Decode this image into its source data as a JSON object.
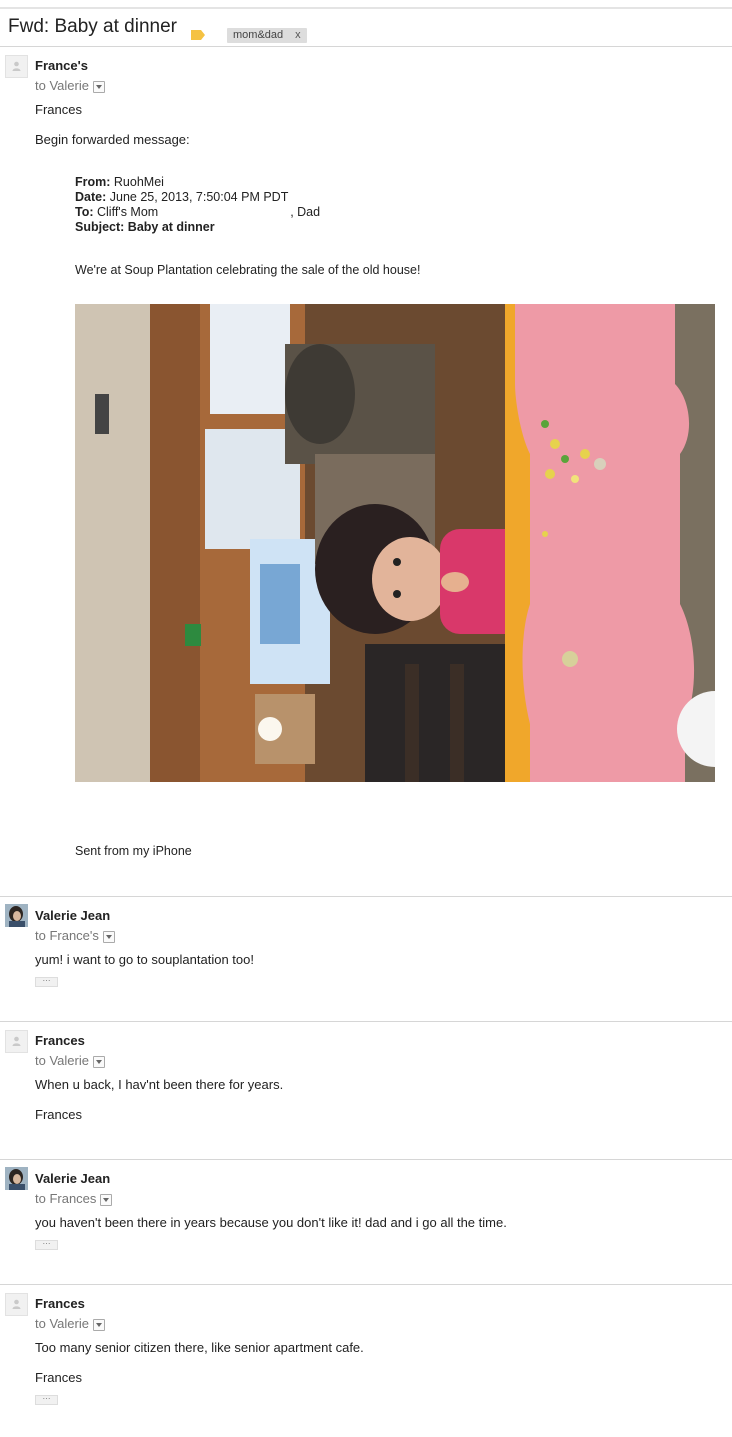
{
  "thread": {
    "subject": "Fwd: Baby at dinner",
    "label_chip": "mom&dad",
    "label_chip_close": "x"
  },
  "colors": {
    "label_tag": "#f5c242",
    "divider": "#d6d6d6"
  },
  "messages": [
    {
      "sender": "France's",
      "to": "to Valerie",
      "avatar": "blank-person-icon",
      "body_lines": [
        "Frances",
        "Begin forwarded message:"
      ],
      "forwarded": {
        "from_label": "From:",
        "from": "RuohMei",
        "date_label": "Date:",
        "date": "June 25, 2013, 7:50:04 PM PDT",
        "to_label": "To:",
        "to": "Cliff's Mom",
        "to_suffix": ", Dad",
        "subject_label": "Subject:",
        "subject": "Baby at dinner",
        "text": "We're at Soup Plantation celebrating the sale of the old house!",
        "photo": "baby-at-dinner-photo",
        "signature": "Sent from my iPhone"
      }
    },
    {
      "sender": "Valerie Jean",
      "to": "to France's",
      "avatar": "valerie-photo-avatar",
      "body": "yum! i want to go to souplantation too!",
      "more": "···"
    },
    {
      "sender": "Frances",
      "to": "to Valerie",
      "avatar": "blank-person-icon",
      "body": "When u back, I hav'nt been there for years.",
      "signature": "Frances"
    },
    {
      "sender": "Valerie Jean",
      "to": "to Frances",
      "avatar": "valerie-photo-avatar",
      "body": "you haven't been there in years because you don't like it! dad and i go all the time.",
      "more": "···"
    },
    {
      "sender": "Frances",
      "to": "to Valerie",
      "avatar": "blank-person-icon",
      "body": "Too many senior citizen there, like senior apartment cafe.",
      "signature": "Frances",
      "more": "···"
    }
  ]
}
